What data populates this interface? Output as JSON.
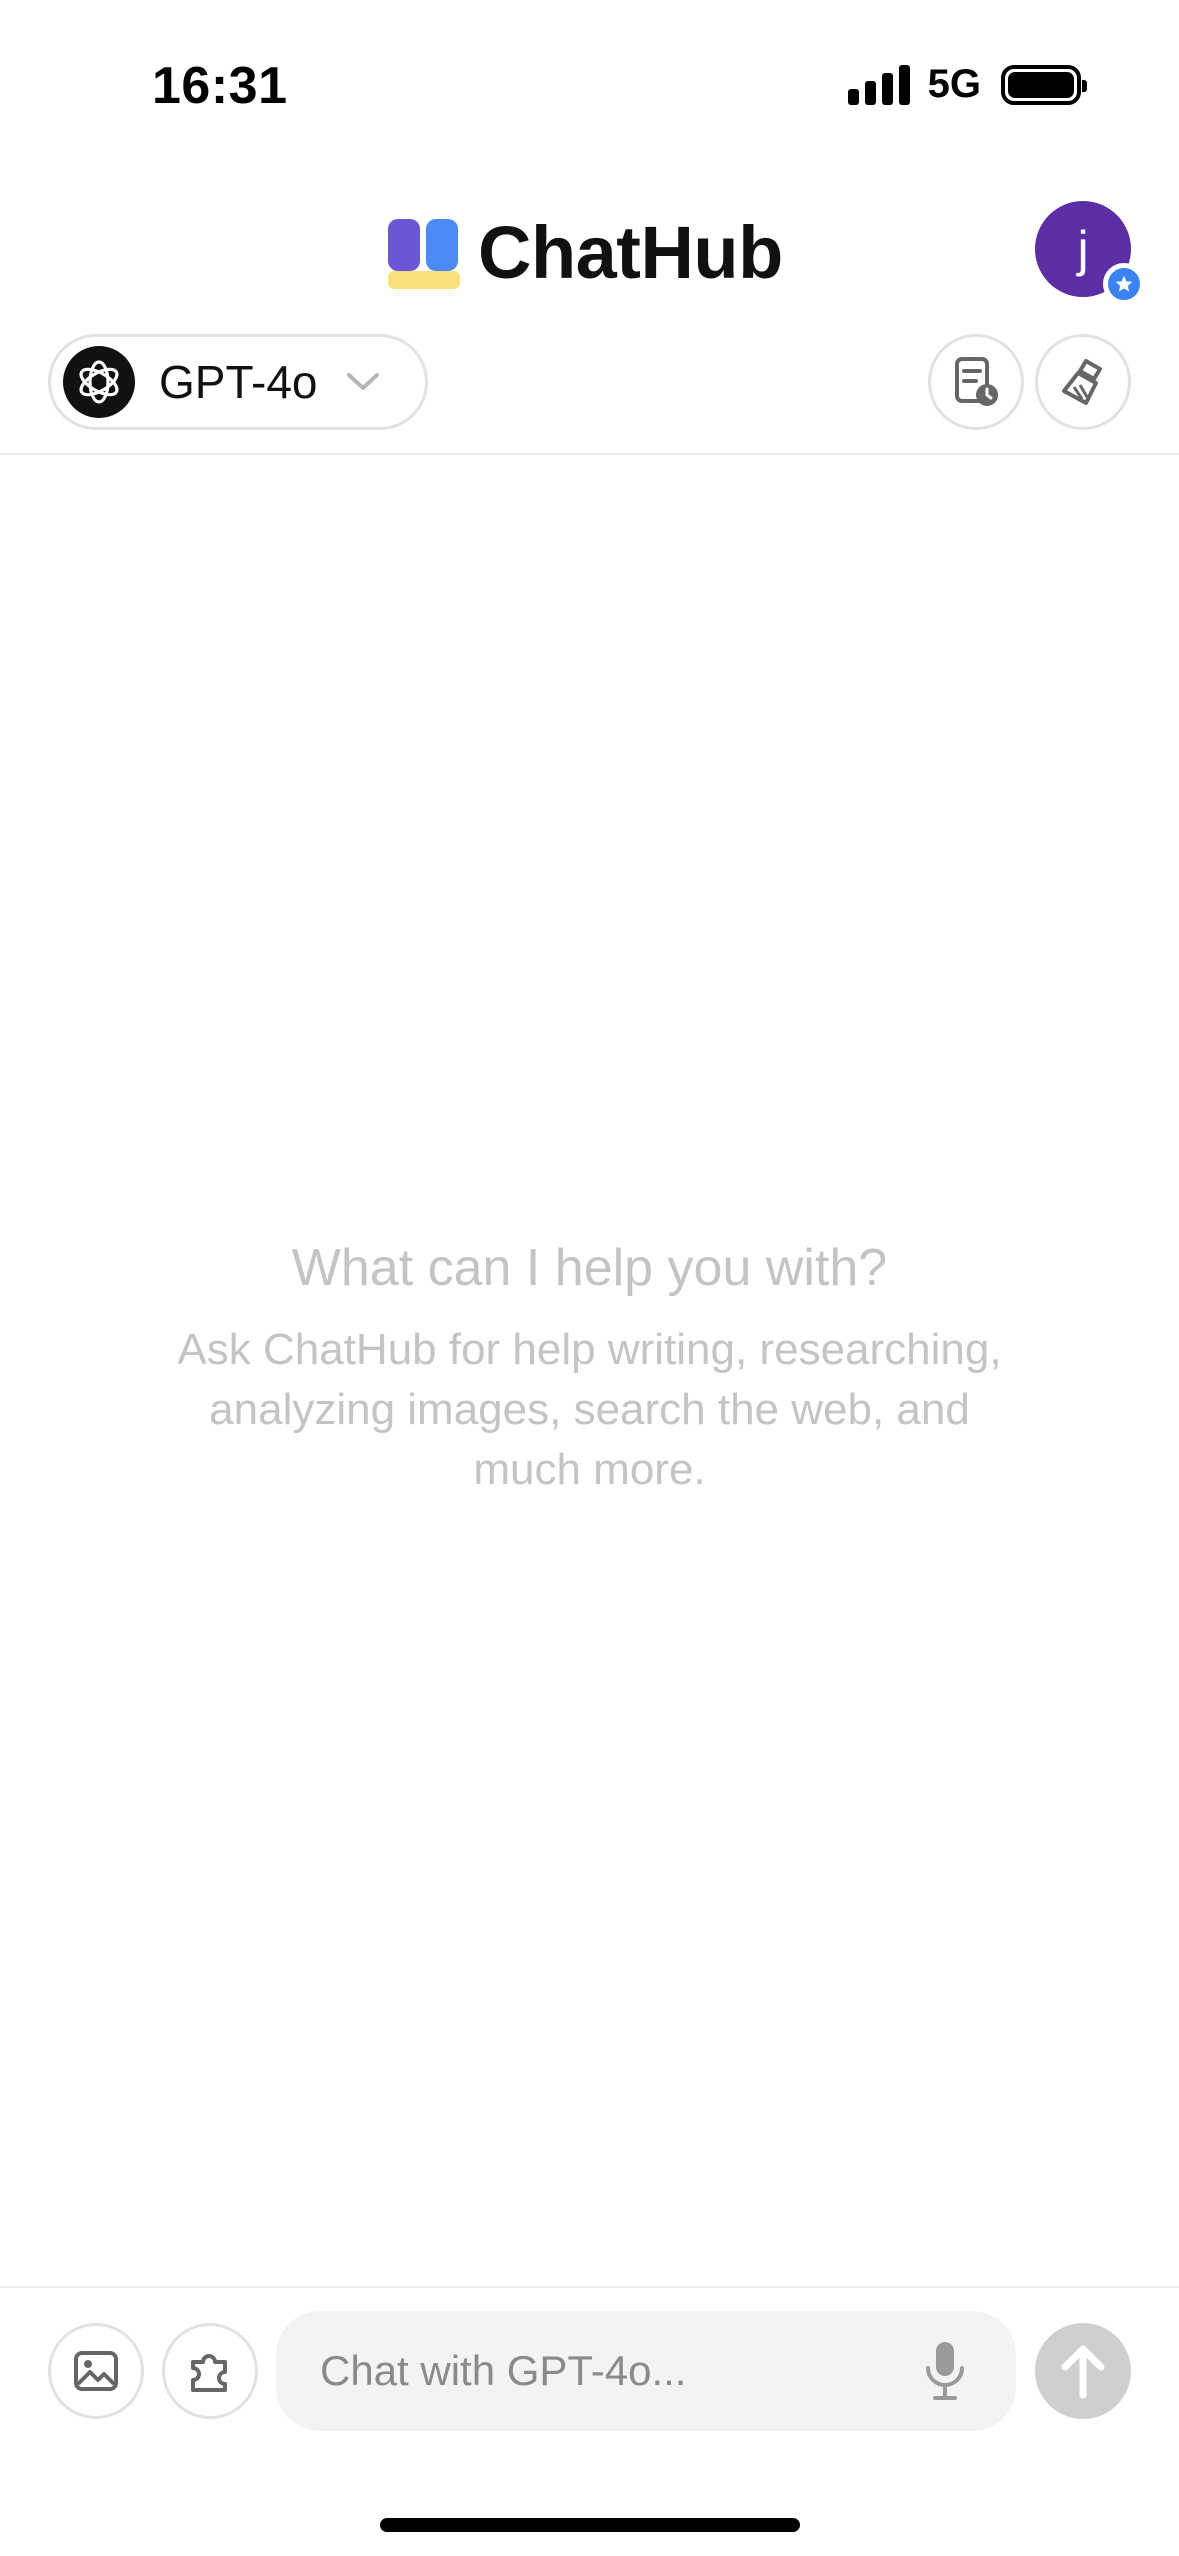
{
  "status_bar": {
    "time": "16:31",
    "network": "5G",
    "icons": [
      "signal-icon",
      "battery-icon"
    ]
  },
  "header": {
    "app_name": "ChatHub",
    "avatar_initial": "j",
    "avatar_color": "#5b2ea6",
    "badge_icon": "star-icon"
  },
  "toolbar": {
    "model_label": "GPT-4o",
    "model_icon": "openai-logo-icon",
    "dropdown_icon": "chevron-down-icon",
    "history_icon": "history-icon",
    "clear_icon": "broom-icon"
  },
  "empty_state": {
    "title": "What can I help you with?",
    "subtitle": "Ask ChatHub for help writing, researching, analyzing images, search the web, and much more."
  },
  "composer": {
    "placeholder": "Chat with GPT-4o...",
    "image_icon": "image-icon",
    "plugin_icon": "puzzle-icon",
    "mic_icon": "microphone-icon",
    "send_icon": "arrow-up-icon"
  },
  "colors": {
    "brand_purple": "#6b57d6",
    "brand_blue": "#4c8bf5",
    "brand_yellow": "#f8df7a",
    "muted_text": "#c4c4c4"
  }
}
